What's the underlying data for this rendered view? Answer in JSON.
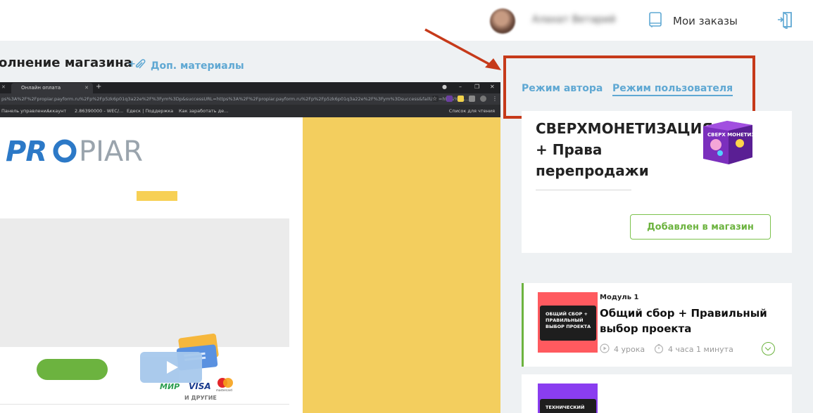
{
  "header": {
    "username": "Алахат Ветарий",
    "orders_label": "Мои заказы"
  },
  "page": {
    "title": "олнение магазина",
    "materials_label": "Доп. материалы"
  },
  "browser": {
    "tab_title": "Онлайн оплата",
    "url": "ps%3A%2F%2Fpropiar.payform.ru%2Fp%2Fp5zk6p01q3a22e%2F%3Fym%3Dp&successURL=https%3A%2F%2Fpropiar.payform.ru%2Fp%2Fp5zk6p01q3a22e%2F%3Fym%3Dsuccess&failURL=https%3A...",
    "bookmarks": [
      "Панель управлени...",
      "Аккаунт",
      "2.86390000 - WEC/...",
      "Едеск | Поддержка",
      "Как заработать де..."
    ],
    "reading_list": "Список для чтения"
  },
  "checkout": {
    "logo_text": "PR PIAR",
    "payment_mir": "МИР",
    "payment_visa": "VISA",
    "payment_mastercard": "mastercard",
    "payment_others": "И ДРУГИЕ"
  },
  "modes": {
    "author": "Режим автора",
    "user": "Режим пользователя"
  },
  "product": {
    "title": "СВЕРХМОНЕТИЗАЦИЯ + Права перепродажи",
    "added_label": "Добавлен в магазин",
    "image_text": "СВЕРХ МОНЕТИЗАЦИЯ"
  },
  "module1": {
    "label": "Модуль 1",
    "title": "Общий сбор + Правильный выбор проекта",
    "thumb_text": "ОБЩИЙ СБОР + ПРАВИЛЬНЫЙ ВЫБОР ПРОЕКТА",
    "lessons": "4 урока",
    "duration": "4 часа 1 минута"
  },
  "module2": {
    "thumb_text": "ТЕХНИЧЕСКИЙ"
  },
  "colors": {
    "accent_blue": "#5fa8d3",
    "green": "#6cb33f",
    "highlight_red": "#c63a1a",
    "yellow": "#f3ce5e"
  }
}
